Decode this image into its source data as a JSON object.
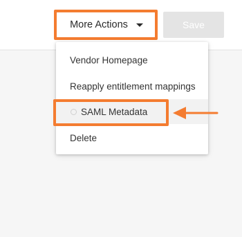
{
  "toolbar": {
    "more_actions_label": "More Actions",
    "save_label": "Save"
  },
  "menu": {
    "items": [
      {
        "label": "Vendor Homepage"
      },
      {
        "label": "Reapply entitlement mappings"
      },
      {
        "label": "SAML Metadata"
      },
      {
        "label": "Delete"
      }
    ]
  },
  "icons": {
    "more_actions_caret": "caret-down-icon",
    "saml_status": "loading-spinner-icon",
    "pointer": "arrow-left-icon"
  },
  "colors": {
    "highlight": "#f47c30",
    "save_disabled_bg": "#e4e4e4",
    "menu_hover_bg": "#f2f2f2",
    "page_bg": "#f6f6f6"
  }
}
